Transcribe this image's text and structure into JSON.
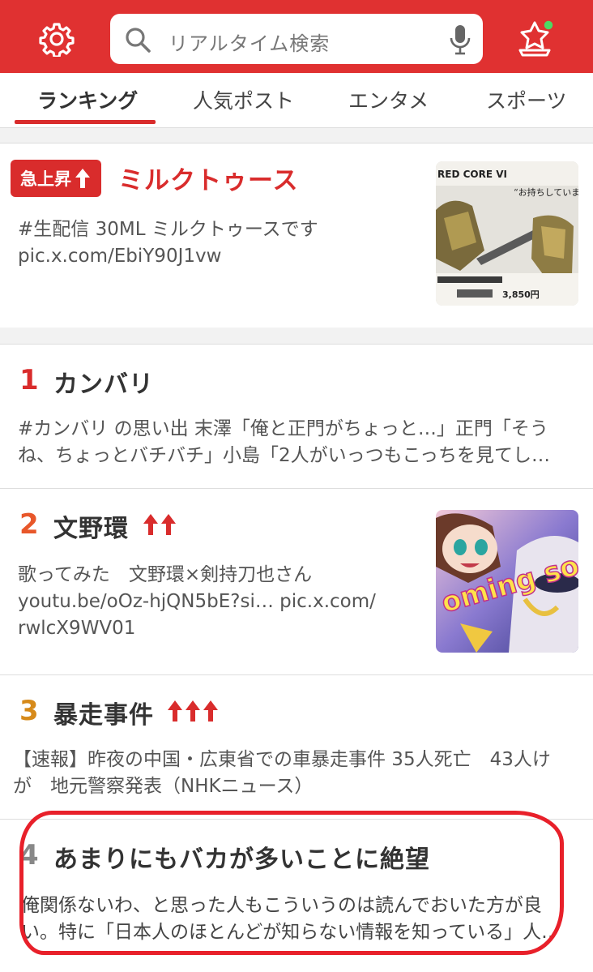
{
  "search": {
    "placeholder": "リアルタイム検索"
  },
  "tabs": [
    {
      "label": "ランキング",
      "active": true
    },
    {
      "label": "人気ポスト"
    },
    {
      "label": "エンタメ"
    },
    {
      "label": "スポーツ"
    }
  ],
  "rising": {
    "badge": "急上昇",
    "title": "ミルクトゥース",
    "snippet": "#生配信 30ML ミルクトゥースです\npic.x.com/EbiY90J1vw",
    "thumb_text_1": "RED CORE VI",
    "thumb_text_2": "“お持ちしていま",
    "thumb_text_3": "3,850円"
  },
  "rankings": [
    {
      "rank": "1",
      "title": "カンバリ",
      "rank_color": "#d92c2c",
      "arrows": 0,
      "snippet": "#カンバリ の思い出 末澤「俺と正門がちょっと…」正門「そう\nね、ちょっとバチバチ」小島「2人がいっつもこっちを見てし…"
    },
    {
      "rank": "2",
      "title": "文野環",
      "rank_color": "#e8572a",
      "arrows": 2,
      "snippet": "歌ってみた　文野環×剣持刀也さん\nyoutu.be/oOz-hjQN5bE?si… pic.x.com/\nrwlcX9WV01",
      "thumb_text": "oming so"
    },
    {
      "rank": "3",
      "title": "暴走事件",
      "rank_color": "#d68a1a",
      "arrows": 3,
      "snippet": "【速報】昨夜の中国・広東省での車暴走事件 35人死亡　43人け\nが　地元警察発表（NHKニュース）"
    },
    {
      "rank": "4",
      "title": "あまりにもバカが多いことに絶望",
      "rank_color": "#888888",
      "arrows": 0,
      "snippet": "俺関係ないわ、と思った人もこういうのは読んでおいた方が良\nい。特に「日本人のほとんどが知らない情報を知っている」人‥"
    }
  ],
  "colors": {
    "brand": "#e03131",
    "accent": "#d92c2c"
  }
}
